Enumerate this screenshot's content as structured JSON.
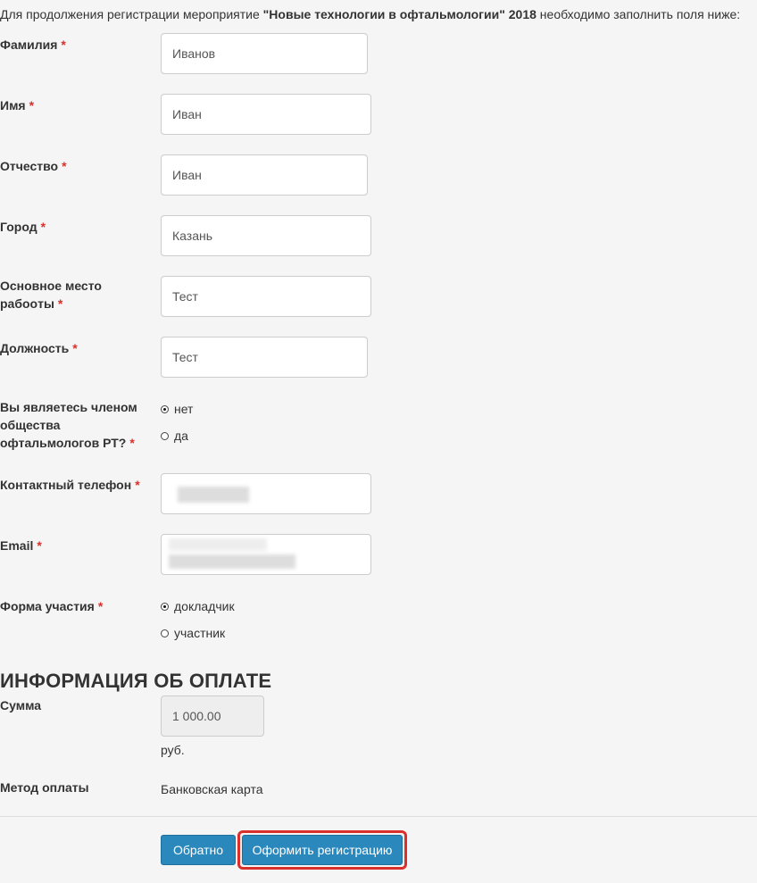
{
  "intro": {
    "before": "Для продолжения регистрации мероприятие ",
    "event": "\"Новые технологии в офтальмологии\" 2018",
    "after": " необходимо заполнить поля ниже:"
  },
  "required_mark": "*",
  "fields": {
    "last_name": {
      "label": "Фамилия",
      "value": "Иванов"
    },
    "first_name": {
      "label": "Имя",
      "value": "Иван"
    },
    "patronymic": {
      "label": "Отчество",
      "value": "Иван"
    },
    "city": {
      "label": "Город",
      "value": "Казань"
    },
    "workplace": {
      "label_line1": "Основное место",
      "label_line2": "рабоoты",
      "value": "Тест"
    },
    "position": {
      "label": "Должность",
      "value": "Тест"
    },
    "member": {
      "label_line1": "Вы являетесь членом",
      "label_line2": "общества",
      "label_line3": "офтальмологов РТ?",
      "options": [
        "нет",
        "да"
      ],
      "selected": "нет"
    },
    "phone": {
      "label": "Контактный телефон",
      "value": ""
    },
    "email": {
      "label": "Email",
      "value": ""
    },
    "participation": {
      "label": "Форма участия",
      "options": [
        "докладчик",
        "участник"
      ],
      "selected": "докладчик"
    }
  },
  "payment": {
    "title": "ИНФОРМАЦИЯ ОБ ОПЛАТЕ",
    "amount_label": "Сумма",
    "amount_value": "1 000.00",
    "currency": "руб.",
    "method_label": "Метод оплаты",
    "method_value": "Банковская карта"
  },
  "buttons": {
    "back": "Обратно",
    "submit": "Оформить регистрацию"
  },
  "colors": {
    "accent": "#2a88bd",
    "required": "#d9302c",
    "highlight": "#d9302c"
  }
}
